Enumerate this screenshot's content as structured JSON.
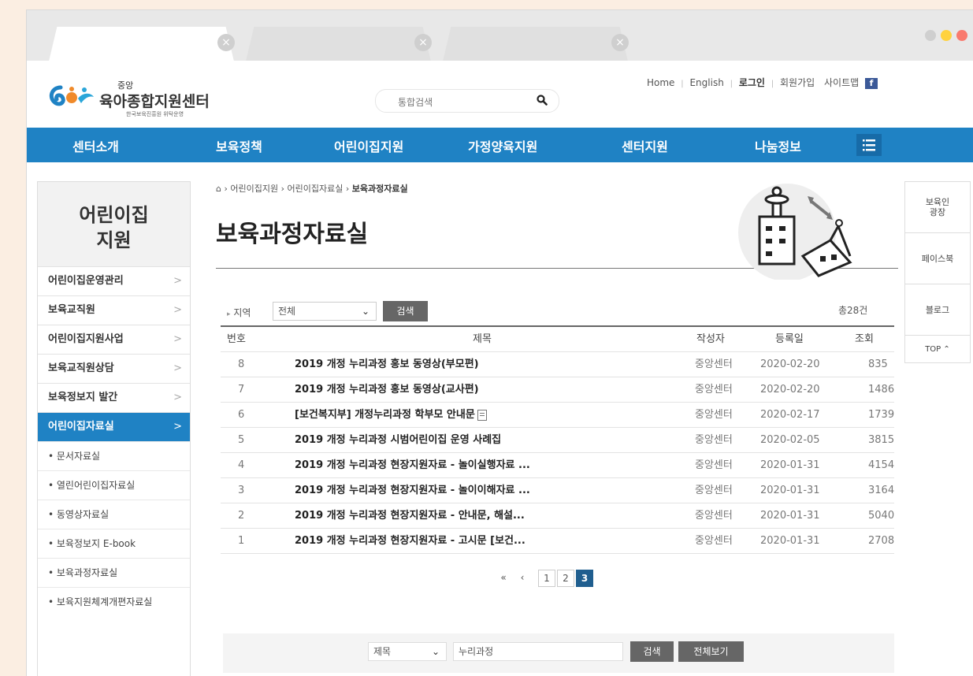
{
  "browser": {
    "tabs": [
      {
        "label": "",
        "active": true
      },
      {
        "label": "",
        "active": false
      },
      {
        "label": "",
        "active": false
      }
    ],
    "close_glyph": "×",
    "window_dot_colors": [
      "#cfcfcf",
      "#ffd23f",
      "#f97a6e"
    ]
  },
  "header": {
    "util_links": [
      "Home",
      "English",
      "로그인",
      "회원가입",
      "사이트맵"
    ],
    "util_separator": "|",
    "fb_glyph": "f",
    "logo": {
      "small": "중앙",
      "name": "육아종합지원센터",
      "sub": "한국보육진흥원 위탁운영"
    },
    "search": {
      "placeholder": "통합검색"
    }
  },
  "main_nav": [
    "센터소개",
    "보육정책",
    "어린이집지원",
    "가정양육지원",
    "센터지원",
    "나눔정보"
  ],
  "left_nav": {
    "title_line1": "어린이집",
    "title_line2": "지원",
    "chevron": ">",
    "items": [
      {
        "label": "어린이집운영관리"
      },
      {
        "label": "보육교직원"
      },
      {
        "label": "어린이집지원사업"
      },
      {
        "label": "보육교직원상담"
      },
      {
        "label": "보육정보지 발간"
      },
      {
        "label": "어린이집자료실",
        "active": true
      }
    ],
    "subitems": [
      "• 문서자료실",
      "• 열린어린이집자료실",
      "• 동영상자료실",
      "• 보육정보지 E-book",
      "• 보육과정자료실",
      "• 보육지원체계개편자료실"
    ]
  },
  "breadcrumb": {
    "home_glyph": "⌂",
    "sep": " › ",
    "items": [
      "어린이집지원",
      "어린이집자료실",
      "보육과정자료실"
    ]
  },
  "page_title": "보육과정자료실",
  "filter": {
    "marker": "▸",
    "label": "지역",
    "select_value": "전체",
    "caret": "⌄",
    "search_label": "검색",
    "total": "총28건"
  },
  "table": {
    "headers": {
      "no": "번호",
      "title": "제목",
      "author": "작성자",
      "date": "등록일",
      "views": "조회"
    },
    "rows": [
      {
        "no": "8",
        "title": "2019 개정 누리과정 홍보 동영상(부모편)",
        "author": "중앙센터",
        "date": "2020-02-20",
        "views": "835",
        "attach": false
      },
      {
        "no": "7",
        "title": "2019 개정 누리과정 홍보 동영상(교사편)",
        "author": "중앙센터",
        "date": "2020-02-20",
        "views": "1486",
        "attach": false
      },
      {
        "no": "6",
        "title": "[보건복지부] 개정누리과정 학부모 안내문",
        "author": "중앙센터",
        "date": "2020-02-17",
        "views": "1739",
        "attach": true
      },
      {
        "no": "5",
        "title": "2019 개정 누리과정 시범어린이집 운영 사례집",
        "author": "중앙센터",
        "date": "2020-02-05",
        "views": "3815",
        "attach": false
      },
      {
        "no": "4",
        "title": "2019 개정 누리과정 현장지원자료 - 놀이실행자료 ...",
        "author": "중앙센터",
        "date": "2020-01-31",
        "views": "4154",
        "attach": false
      },
      {
        "no": "3",
        "title": "2019 개정 누리과정 현장지원자료 - 놀이이해자료 ...",
        "author": "중앙센터",
        "date": "2020-01-31",
        "views": "3164",
        "attach": false
      },
      {
        "no": "2",
        "title": "2019 개정 누리과정 현장지원자료 - 안내문, 해설...",
        "author": "중앙센터",
        "date": "2020-01-31",
        "views": "5040",
        "attach": false
      },
      {
        "no": "1",
        "title": "2019 개정 누리과정 현장지원자료 - 고시문 [보건...",
        "author": "중앙센터",
        "date": "2020-01-31",
        "views": "2708",
        "attach": false
      }
    ]
  },
  "pagination": {
    "first": "«",
    "prev": "‹",
    "pages": [
      "1",
      "2",
      "3"
    ],
    "current": "3"
  },
  "bottom_search": {
    "field_value": "제목",
    "caret": "⌄",
    "query": "누리과정",
    "search_label": "검색",
    "view_all_label": "전체보기"
  },
  "quick_menu": [
    {
      "label_line1": "보육인",
      "label_line2": "광장"
    },
    {
      "label_line1": "페이스북",
      "label_line2": ""
    },
    {
      "label_line1": "블로그",
      "label_line2": ""
    },
    {
      "label_line1": "TOP ⌃",
      "label_line2": ""
    }
  ],
  "colors": {
    "accent": "#1f82c4",
    "page_bg": "#fbeee2"
  }
}
